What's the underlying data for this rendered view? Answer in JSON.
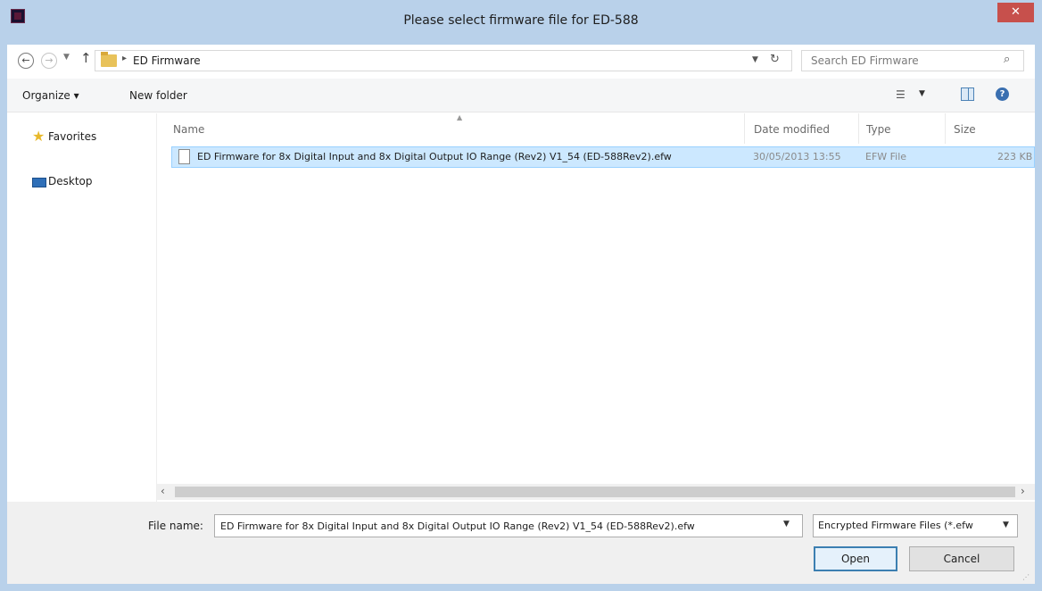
{
  "window": {
    "title": "Please select firmware file for ED-588",
    "close_glyph": "✕"
  },
  "address": {
    "crumb": "ED Firmware",
    "search_placeholder": "Search ED Firmware"
  },
  "toolbar": {
    "organize": "Organize ▾",
    "new_folder": "New folder"
  },
  "navpane": {
    "items": [
      "Favorites",
      "Desktop"
    ]
  },
  "columns": {
    "name": "Name",
    "date": "Date modified",
    "type": "Type",
    "size": "Size"
  },
  "files": [
    {
      "name": "ED Firmware for 8x Digital Input and 8x Digital Output IO Range (Rev2) V1_54 (ED-588Rev2).efw",
      "date": "30/05/2013 13:55",
      "type": "EFW File",
      "size": "223 KB"
    }
  ],
  "bottom": {
    "file_name_label": "File name:",
    "file_name_value": "ED Firmware for 8x Digital Input and 8x Digital Output IO Range (Rev2) V1_54 (ED-588Rev2).efw",
    "filter": "Encrypted Firmware Files (*.efw",
    "open": "Open",
    "cancel": "Cancel"
  },
  "colors": {
    "frame": "#b9d1ea",
    "close": "#c7504c",
    "selection": "#cce8ff"
  }
}
